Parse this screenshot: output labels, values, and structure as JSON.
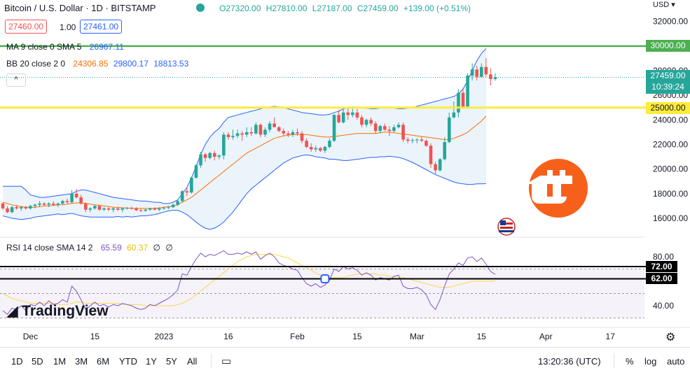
{
  "header": {
    "symbol": "Bitcoin / U.S. Dollar · 1D · BITSTAMP",
    "open": "O27320.00",
    "high": "H27810.00",
    "low": "L27187.00",
    "close": "C27459.00",
    "change": "+139.00 (+0.51%)",
    "sell_price": "27460.00",
    "spread": "1.00",
    "buy_price": "27461.00",
    "currency": "USD",
    "collapse_glyph": "^"
  },
  "indicators": {
    "ma_label": "MA 9 close 0 SMA 5",
    "ma_value": "26967.11",
    "bb_label": "BB 20 close 2 0",
    "bb_basis": "24306.85",
    "bb_upper": "29800.17",
    "bb_lower": "18813.53",
    "rsi_label": "RSI 14 close SMA 14 2",
    "rsi_value": "65.59",
    "rsi_sma": "60.37",
    "rsi_extra1": "∅",
    "rsi_extra2": "∅"
  },
  "price_axis": {
    "ticks": [
      "32000.00",
      "28000.00",
      "26000.00",
      "24000.00",
      "22000.00",
      "20000.00",
      "18000.00",
      "16000.00"
    ],
    "last_price": "27459.00",
    "countdown": "10:39:24",
    "level_30000": "30000.00",
    "level_25000": "25000.00"
  },
  "rsi_axis": {
    "ticks": [
      "80.00",
      "40.00"
    ],
    "level_72": "72.00",
    "level_62": "62.00"
  },
  "time_axis": [
    "Dec",
    "15",
    "2023",
    "16",
    "Feb",
    "15",
    "Mar",
    "15",
    "Apr",
    "17"
  ],
  "watermark": "TradingView",
  "bottom_bar": {
    "timeframes": [
      "1D",
      "5D",
      "1M",
      "3M",
      "6M",
      "YTD",
      "1Y",
      "5Y",
      "All"
    ],
    "clock": "13:20:36 (UTC)",
    "percent": "%",
    "log": "log",
    "auto": "auto"
  },
  "colors": {
    "up": "#26a69a",
    "down": "#ef5350",
    "bb_upper": "#2962ff",
    "bb_basis": "#ff6d00",
    "rsi_line": "#7e57c2",
    "rsi_sma": "#f7d94c",
    "level_green": "#4caf50",
    "level_yellow": "#ffeb3b",
    "logo_orange": "#f7601a"
  },
  "chart_data": {
    "type": "candlestick",
    "ohlc": [
      [
        17200,
        17300,
        16700,
        16800
      ],
      [
        16800,
        17000,
        16400,
        16500
      ],
      [
        16500,
        17000,
        16400,
        16900
      ],
      [
        16900,
        17100,
        16700,
        16800
      ],
      [
        16800,
        17000,
        16600,
        16900
      ],
      [
        16900,
        17000,
        16700,
        16800
      ],
      [
        16800,
        17100,
        16700,
        17000
      ],
      [
        17000,
        17200,
        16800,
        17100
      ],
      [
        17100,
        17400,
        16900,
        17200
      ],
      [
        17200,
        17300,
        17000,
        17100
      ],
      [
        17100,
        17300,
        16900,
        17200
      ],
      [
        17200,
        17400,
        17000,
        17100
      ],
      [
        17100,
        17300,
        16900,
        17200
      ],
      [
        17200,
        17500,
        17100,
        17400
      ],
      [
        17400,
        17600,
        17200,
        17300
      ],
      [
        17300,
        18300,
        17200,
        18000
      ],
      [
        18000,
        18400,
        17600,
        17700
      ],
      [
        17700,
        17900,
        17100,
        17200
      ],
      [
        17200,
        17300,
        16500,
        16700
      ],
      [
        16700,
        16900,
        16500,
        16800
      ],
      [
        16800,
        17100,
        16700,
        17000
      ],
      [
        17000,
        17100,
        16600,
        16700
      ],
      [
        16700,
        16900,
        16600,
        16800
      ],
      [
        16800,
        16900,
        16600,
        16700
      ],
      [
        16700,
        16900,
        16500,
        16800
      ],
      [
        16800,
        16900,
        16600,
        16700
      ],
      [
        16700,
        16900,
        16500,
        16800
      ],
      [
        16800,
        16900,
        16700,
        16850
      ],
      [
        16850,
        16950,
        16700,
        16800
      ],
      [
        16800,
        16900,
        16600,
        16650
      ],
      [
        16650,
        16800,
        16500,
        16600
      ],
      [
        16600,
        16800,
        16550,
        16700
      ],
      [
        16700,
        16850,
        16600,
        16800
      ],
      [
        16800,
        16900,
        16650,
        16700
      ],
      [
        16700,
        16900,
        16600,
        16800
      ],
      [
        16800,
        16950,
        16700,
        16850
      ],
      [
        16850,
        17000,
        16750,
        16900
      ],
      [
        16900,
        17200,
        16850,
        17100
      ],
      [
        17100,
        17500,
        17000,
        17400
      ],
      [
        17400,
        18300,
        17300,
        18200
      ],
      [
        18200,
        18500,
        17800,
        18100
      ],
      [
        18100,
        19400,
        18000,
        19300
      ],
      [
        19300,
        20400,
        19200,
        20300
      ],
      [
        20300,
        21400,
        20100,
        21200
      ],
      [
        21200,
        21300,
        20600,
        20900
      ],
      [
        20900,
        21400,
        20800,
        21300
      ],
      [
        21300,
        21500,
        20700,
        21000
      ],
      [
        21000,
        21200,
        20800,
        21100
      ],
      [
        21100,
        23000,
        20800,
        22800
      ],
      [
        22800,
        23000,
        22400,
        22600
      ],
      [
        22600,
        23200,
        22400,
        22700
      ],
      [
        22700,
        23200,
        22500,
        22900
      ],
      [
        22900,
        23100,
        22300,
        22800
      ],
      [
        22800,
        23400,
        22600,
        23000
      ],
      [
        23000,
        23400,
        22700,
        22900
      ],
      [
        22900,
        23800,
        22800,
        23600
      ],
      [
        23600,
        23700,
        22600,
        22800
      ],
      [
        22800,
        23400,
        22600,
        23200
      ],
      [
        23200,
        23900,
        23000,
        23700
      ],
      [
        23700,
        24200,
        23500,
        23400
      ],
      [
        23400,
        23500,
        23000,
        23100
      ],
      [
        23100,
        23300,
        22700,
        22900
      ],
      [
        22900,
        23100,
        22600,
        22800
      ],
      [
        22800,
        23200,
        22600,
        23000
      ],
      [
        23000,
        23300,
        22700,
        22900
      ],
      [
        22900,
        23100,
        22100,
        22300
      ],
      [
        22300,
        22500,
        21700,
        21800
      ],
      [
        21800,
        22100,
        21400,
        21600
      ],
      [
        21600,
        21900,
        21400,
        21700
      ],
      [
        21700,
        21800,
        21400,
        21500
      ],
      [
        21500,
        21900,
        21300,
        21800
      ],
      [
        21800,
        22500,
        21700,
        22300
      ],
      [
        22300,
        24500,
        22200,
        24400
      ],
      [
        24400,
        24800,
        23700,
        23800
      ],
      [
        23800,
        25000,
        23700,
        24600
      ],
      [
        24600,
        25000,
        24000,
        24400
      ],
      [
        24400,
        25100,
        24200,
        24600
      ],
      [
        24600,
        24900,
        24000,
        24200
      ],
      [
        24200,
        24400,
        23400,
        23600
      ],
      [
        23600,
        24100,
        23400,
        24000
      ],
      [
        24000,
        24200,
        23500,
        23700
      ],
      [
        23700,
        23900,
        22900,
        23100
      ],
      [
        23100,
        23600,
        22900,
        23500
      ],
      [
        23500,
        23700,
        23100,
        23200
      ],
      [
        23200,
        23500,
        22700,
        23100
      ],
      [
        23100,
        23600,
        23000,
        23400
      ],
      [
        23400,
        23800,
        23300,
        23600
      ],
      [
        23600,
        23800,
        22200,
        22400
      ],
      [
        22400,
        22600,
        22100,
        22300
      ],
      [
        22300,
        22500,
        22100,
        22350
      ],
      [
        22350,
        22500,
        22100,
        22400
      ],
      [
        22400,
        22600,
        22200,
        22300
      ],
      [
        22300,
        22400,
        21800,
        21900
      ],
      [
        21900,
        22100,
        20100,
        20400
      ],
      [
        20400,
        20600,
        19600,
        19900
      ],
      [
        19900,
        20900,
        19800,
        20800
      ],
      [
        20800,
        22600,
        20700,
        22200
      ],
      [
        22200,
        24600,
        22100,
        24200
      ],
      [
        24200,
        25500,
        24100,
        24600
      ],
      [
        24600,
        26500,
        24200,
        26200
      ],
      [
        26200,
        26600,
        24900,
        25000
      ],
      [
        25000,
        27800,
        24900,
        27600
      ],
      [
        27600,
        28600,
        27200,
        28100
      ],
      [
        28100,
        28400,
        27200,
        27500
      ],
      [
        27500,
        28600,
        27400,
        28300
      ],
      [
        28300,
        29000,
        27500,
        27700
      ],
      [
        27700,
        28200,
        26800,
        27320
      ],
      [
        27320,
        27810,
        27187,
        27459
      ]
    ],
    "bb_upper": [
      18600,
      18600,
      18600,
      18600,
      18600,
      18300,
      17900,
      17800,
      17700,
      17700,
      17750,
      17800,
      17850,
      17900,
      17950,
      18000,
      18200,
      18300,
      18300,
      18200,
      18100,
      18000,
      17900,
      17800,
      17700,
      17650,
      17600,
      17550,
      17500,
      17450,
      17400,
      17400,
      17350,
      17300,
      17300,
      17200,
      17200,
      17300,
      17500,
      18000,
      18500,
      19300,
      20200,
      21200,
      22000,
      22600,
      23000,
      23300,
      23800,
      24200,
      24300,
      24400,
      24500,
      24600,
      24700,
      24800,
      24900,
      25000,
      25050,
      25100,
      25050,
      25000,
      24900,
      24800,
      24700,
      24600,
      24550,
      24500,
      24450,
      24400,
      24400,
      24450,
      24600,
      24700,
      24900,
      25000,
      25050,
      25050,
      25000,
      24950,
      24900,
      24900,
      24950,
      25000,
      25000,
      24950,
      24900,
      24900,
      24950,
      25000,
      25100,
      25200,
      25300,
      25400,
      25500,
      25600,
      25700,
      25800,
      25900,
      26100,
      26500,
      27200,
      28000,
      28800,
      29400,
      29800
    ],
    "bb_basis": [
      17300,
      17200,
      17100,
      17000,
      16950,
      16900,
      16900,
      16900,
      16950,
      17000,
      17000,
      17050,
      17100,
      17100,
      17150,
      17200,
      17250,
      17250,
      17200,
      17150,
      17100,
      17050,
      17000,
      16950,
      16900,
      16900,
      16850,
      16850,
      16800,
      16800,
      16800,
      16800,
      16800,
      16800,
      16850,
      16900,
      16950,
      17000,
      17100,
      17300,
      17500,
      17700,
      18000,
      18300,
      18600,
      18900,
      19200,
      19500,
      19800,
      20100,
      20400,
      20700,
      21000,
      21300,
      21500,
      21700,
      21900,
      22100,
      22300,
      22500,
      22600,
      22700,
      22750,
      22800,
      22800,
      22800,
      22800,
      22750,
      22700,
      22650,
      22600,
      22600,
      22650,
      22700,
      22750,
      22800,
      22850,
      22900,
      22900,
      22900,
      22900,
      22900,
      22950,
      23000,
      23000,
      22950,
      22900,
      22850,
      22800,
      22750,
      22700,
      22650,
      22600,
      22550,
      22500,
      22450,
      22400,
      22400,
      22500,
      22650,
      22800,
      23000,
      23300,
      23600,
      23900,
      24306.85
    ],
    "bb_lower": [
      16200,
      16100,
      16000,
      15950,
      15900,
      15950,
      16000,
      16100,
      16150,
      16200,
      16250,
      16300,
      16350,
      16300,
      16350,
      16400,
      16300,
      16200,
      16150,
      16100,
      16100,
      16100,
      16100,
      16100,
      16100,
      16150,
      16100,
      16150,
      16100,
      16150,
      16200,
      16200,
      16250,
      16300,
      16400,
      16500,
      16600,
      16650,
      16650,
      16500,
      16300,
      16000,
      15700,
      15400,
      15200,
      15100,
      15200,
      15400,
      15700,
      16100,
      16500,
      17000,
      17500,
      18000,
      18400,
      18700,
      19000,
      19300,
      19600,
      19900,
      20200,
      20500,
      20700,
      20900,
      21000,
      21100,
      21150,
      21100,
      21000,
      20950,
      20900,
      20800,
      20800,
      20750,
      20700,
      20700,
      20750,
      20800,
      20850,
      20900,
      20950,
      20950,
      21000,
      21000,
      21050,
      21000,
      20950,
      20850,
      20700,
      20550,
      20350,
      20150,
      19950,
      19750,
      19550,
      19400,
      19250,
      19100,
      18950,
      18850,
      18800,
      18750,
      18750,
      18800,
      18800,
      18813.53
    ],
    "rsi": [
      36,
      33,
      38,
      37,
      40,
      36,
      41,
      40,
      43,
      40,
      44,
      41,
      42,
      45,
      43,
      56,
      52,
      45,
      37,
      40,
      43,
      40,
      41,
      39,
      41,
      40,
      42,
      41,
      40,
      38,
      37,
      38,
      41,
      40,
      42,
      44,
      46,
      49,
      53,
      66,
      65,
      72,
      78,
      83,
      80,
      82,
      81,
      83,
      85,
      82,
      82,
      83,
      82,
      84,
      82,
      84,
      78,
      81,
      83,
      80,
      75,
      73,
      72,
      70,
      69,
      63,
      58,
      56,
      58,
      55,
      57,
      61,
      70,
      68,
      72,
      70,
      71,
      69,
      65,
      67,
      65,
      61,
      63,
      62,
      61,
      64,
      65,
      56,
      54,
      54,
      55,
      53,
      49,
      41,
      37,
      45,
      56,
      66,
      70,
      75,
      73,
      79,
      80,
      76,
      79,
      74,
      68,
      65.59
    ],
    "rsi_sma": [
      50,
      48,
      46,
      45,
      44,
      43,
      42,
      42,
      42,
      42,
      42,
      42,
      41,
      41,
      41,
      42,
      43,
      43,
      42,
      42,
      42,
      42,
      42,
      42,
      42,
      42,
      41,
      41,
      41,
      41,
      41,
      40,
      40,
      40,
      40,
      40,
      40,
      40,
      41,
      42,
      44,
      46,
      49,
      52,
      55,
      58,
      61,
      64,
      67,
      70,
      73,
      76,
      78,
      80,
      81,
      82,
      82,
      82,
      82,
      82,
      81,
      80,
      79,
      77,
      75,
      73,
      71,
      69,
      67,
      65,
      64,
      63,
      63,
      63,
      63,
      64,
      65,
      66,
      66,
      66,
      66,
      66,
      65,
      65,
      64,
      64,
      64,
      63,
      62,
      61,
      60,
      59,
      58,
      57,
      56,
      55,
      55,
      55,
      56,
      57,
      58,
      59,
      60,
      60,
      60,
      60,
      60,
      60.37
    ],
    "levels": [
      30000,
      25000
    ],
    "rsi_levels": [
      72,
      62
    ]
  }
}
